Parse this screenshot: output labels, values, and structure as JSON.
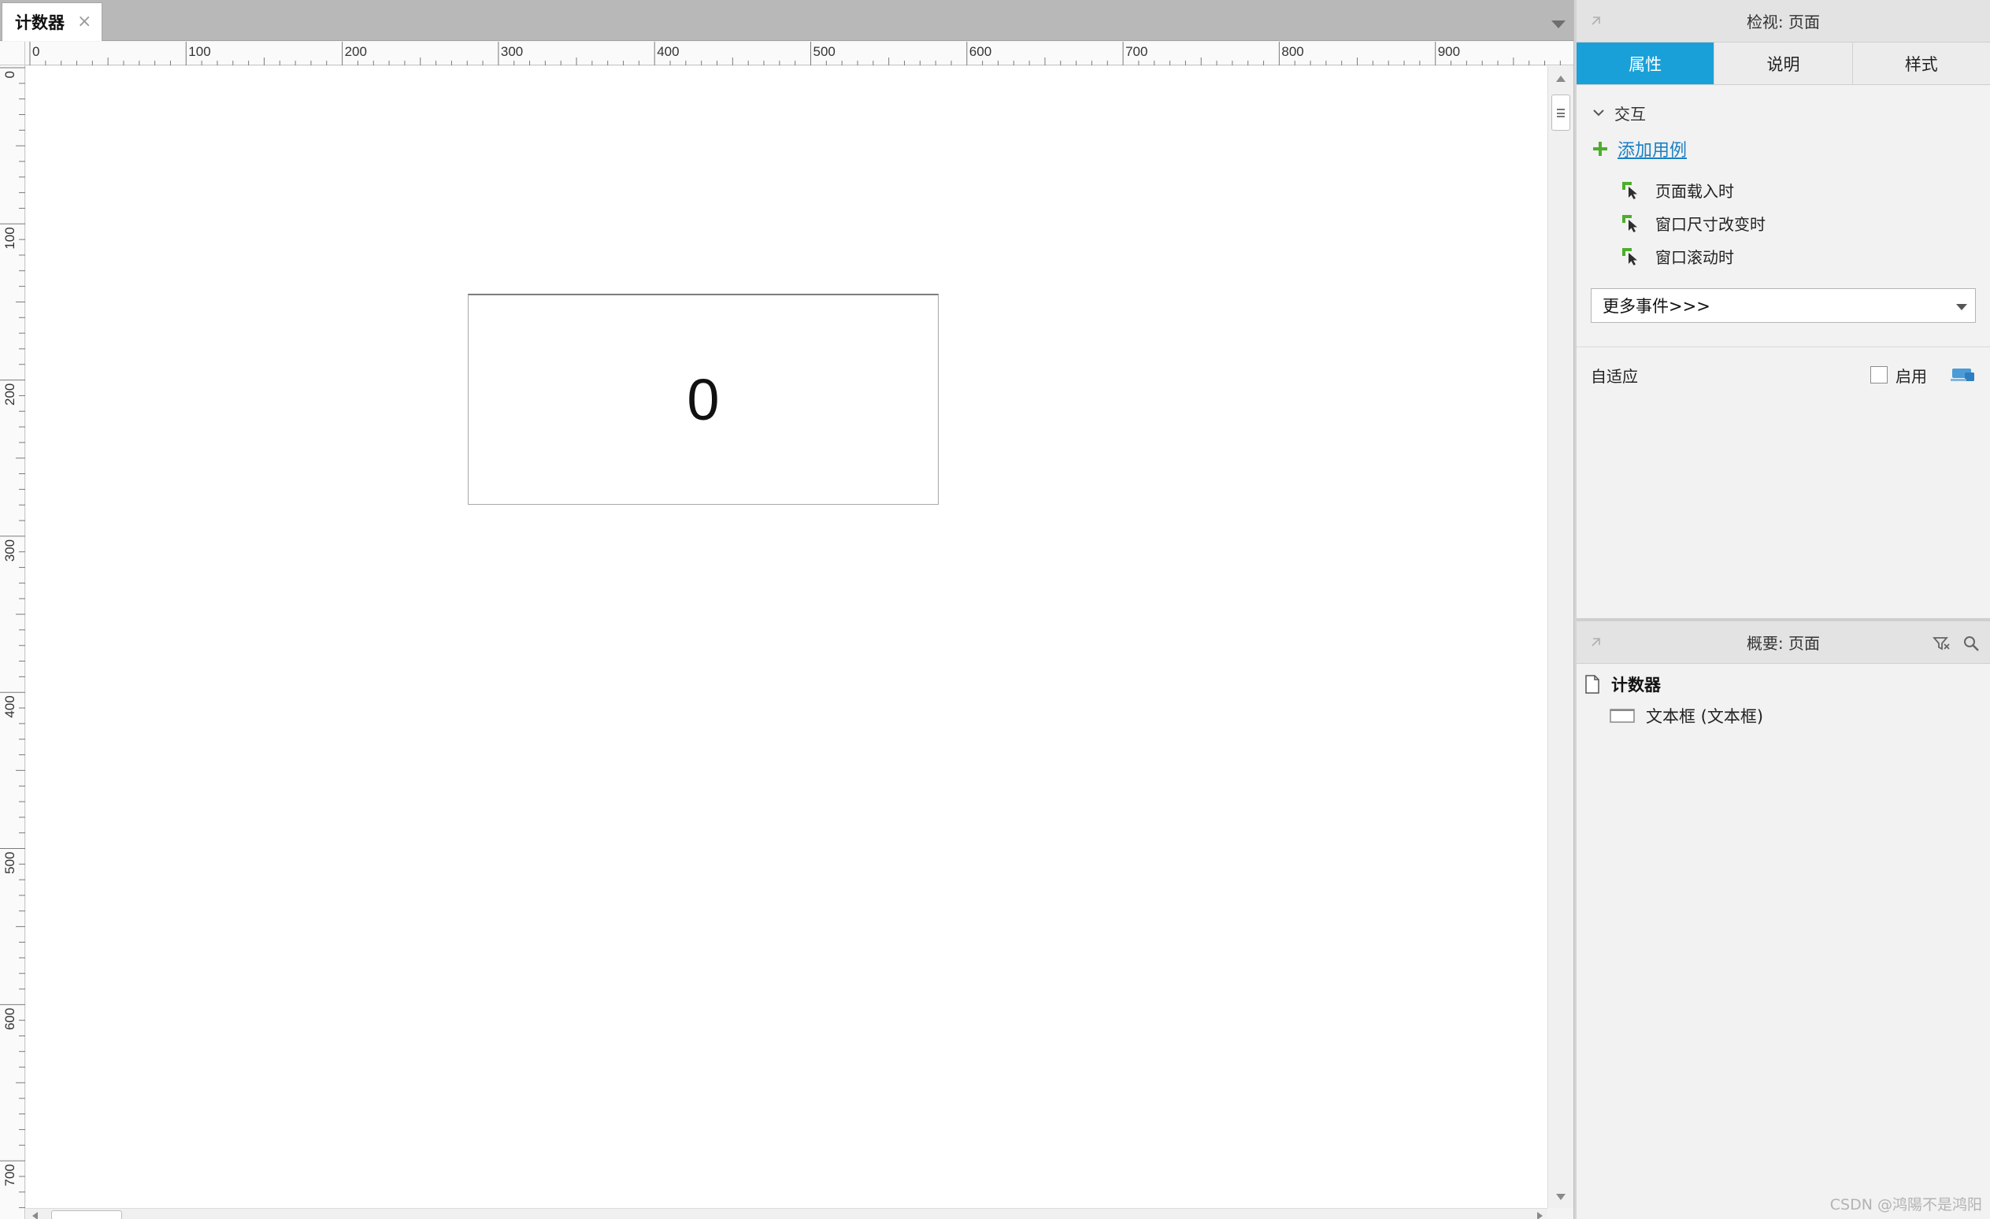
{
  "document_tab": {
    "title": "计数器",
    "close_glyph": "×"
  },
  "ruler": {
    "horizontal_labels": [
      "0",
      "100",
      "200",
      "300",
      "400",
      "500",
      "600",
      "700",
      "800",
      "900"
    ],
    "vertical_labels": [
      "0",
      "100",
      "200",
      "300",
      "400",
      "500",
      "600",
      "700"
    ]
  },
  "canvas": {
    "text_widget_value": "0"
  },
  "inspector": {
    "title": "检视: 页面",
    "tabs": [
      {
        "label": "属性",
        "active": true
      },
      {
        "label": "说明",
        "active": false
      },
      {
        "label": "样式",
        "active": false
      }
    ],
    "interaction_section": "交互",
    "add_case": "添加用例",
    "events": [
      "页面载入时",
      "窗口尺寸改变时",
      "窗口滚动时"
    ],
    "more_events": "更多事件>>>",
    "adaptive_label": "自适应",
    "enable_label": "启用",
    "enable_checked": false
  },
  "outline": {
    "title": "概要: 页面",
    "page_name": "计数器",
    "child_item": "文本框 (文本框)"
  },
  "watermark": "CSDN @鸿陽不是鸿阳",
  "colors": {
    "accent_tab": "#1aa0d8",
    "link": "#1a7fc4",
    "event_icon_green": "#4caf2a"
  },
  "icons": {
    "pin": "pin-icon",
    "chevron": "chevron-down-icon",
    "plus": "plus-icon",
    "event": "cursor-event-icon",
    "filter": "filter-icon",
    "search": "search-icon",
    "page": "page-icon",
    "device": "device-icon"
  }
}
